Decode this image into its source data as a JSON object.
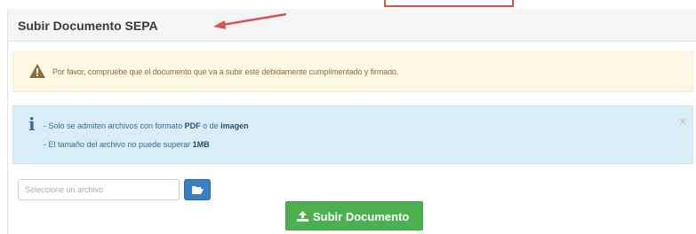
{
  "panel": {
    "title": "Subir Documento SEPA"
  },
  "warning": {
    "icon": "warning-triangle-icon",
    "text": "Por favor, compruebe que el documento que va a subir esté debidamente cumplimentado y firmado."
  },
  "info": {
    "icon": "info-icon",
    "icon_glyph": "i",
    "line1_prefix": "- Solo se admiten archivos con formato",
    "line1_pdf": "PDF",
    "line1_middle": "o de",
    "line1_imagen": "imagen",
    "line2_prefix": "- El tamaño del archivo no puede superar",
    "line2_size": "1MB",
    "close_glyph": "×"
  },
  "file": {
    "placeholder": "Seleccione un archivo",
    "browse_icon": "folder-open-icon"
  },
  "upload": {
    "icon": "upload-icon",
    "label": "Subir Documento"
  },
  "colors": {
    "warning_bg": "#fcf8e3",
    "info_bg": "#d9edf7",
    "primary": "#3a7fc1",
    "success": "#4caf50",
    "annotation": "#d9534f"
  }
}
